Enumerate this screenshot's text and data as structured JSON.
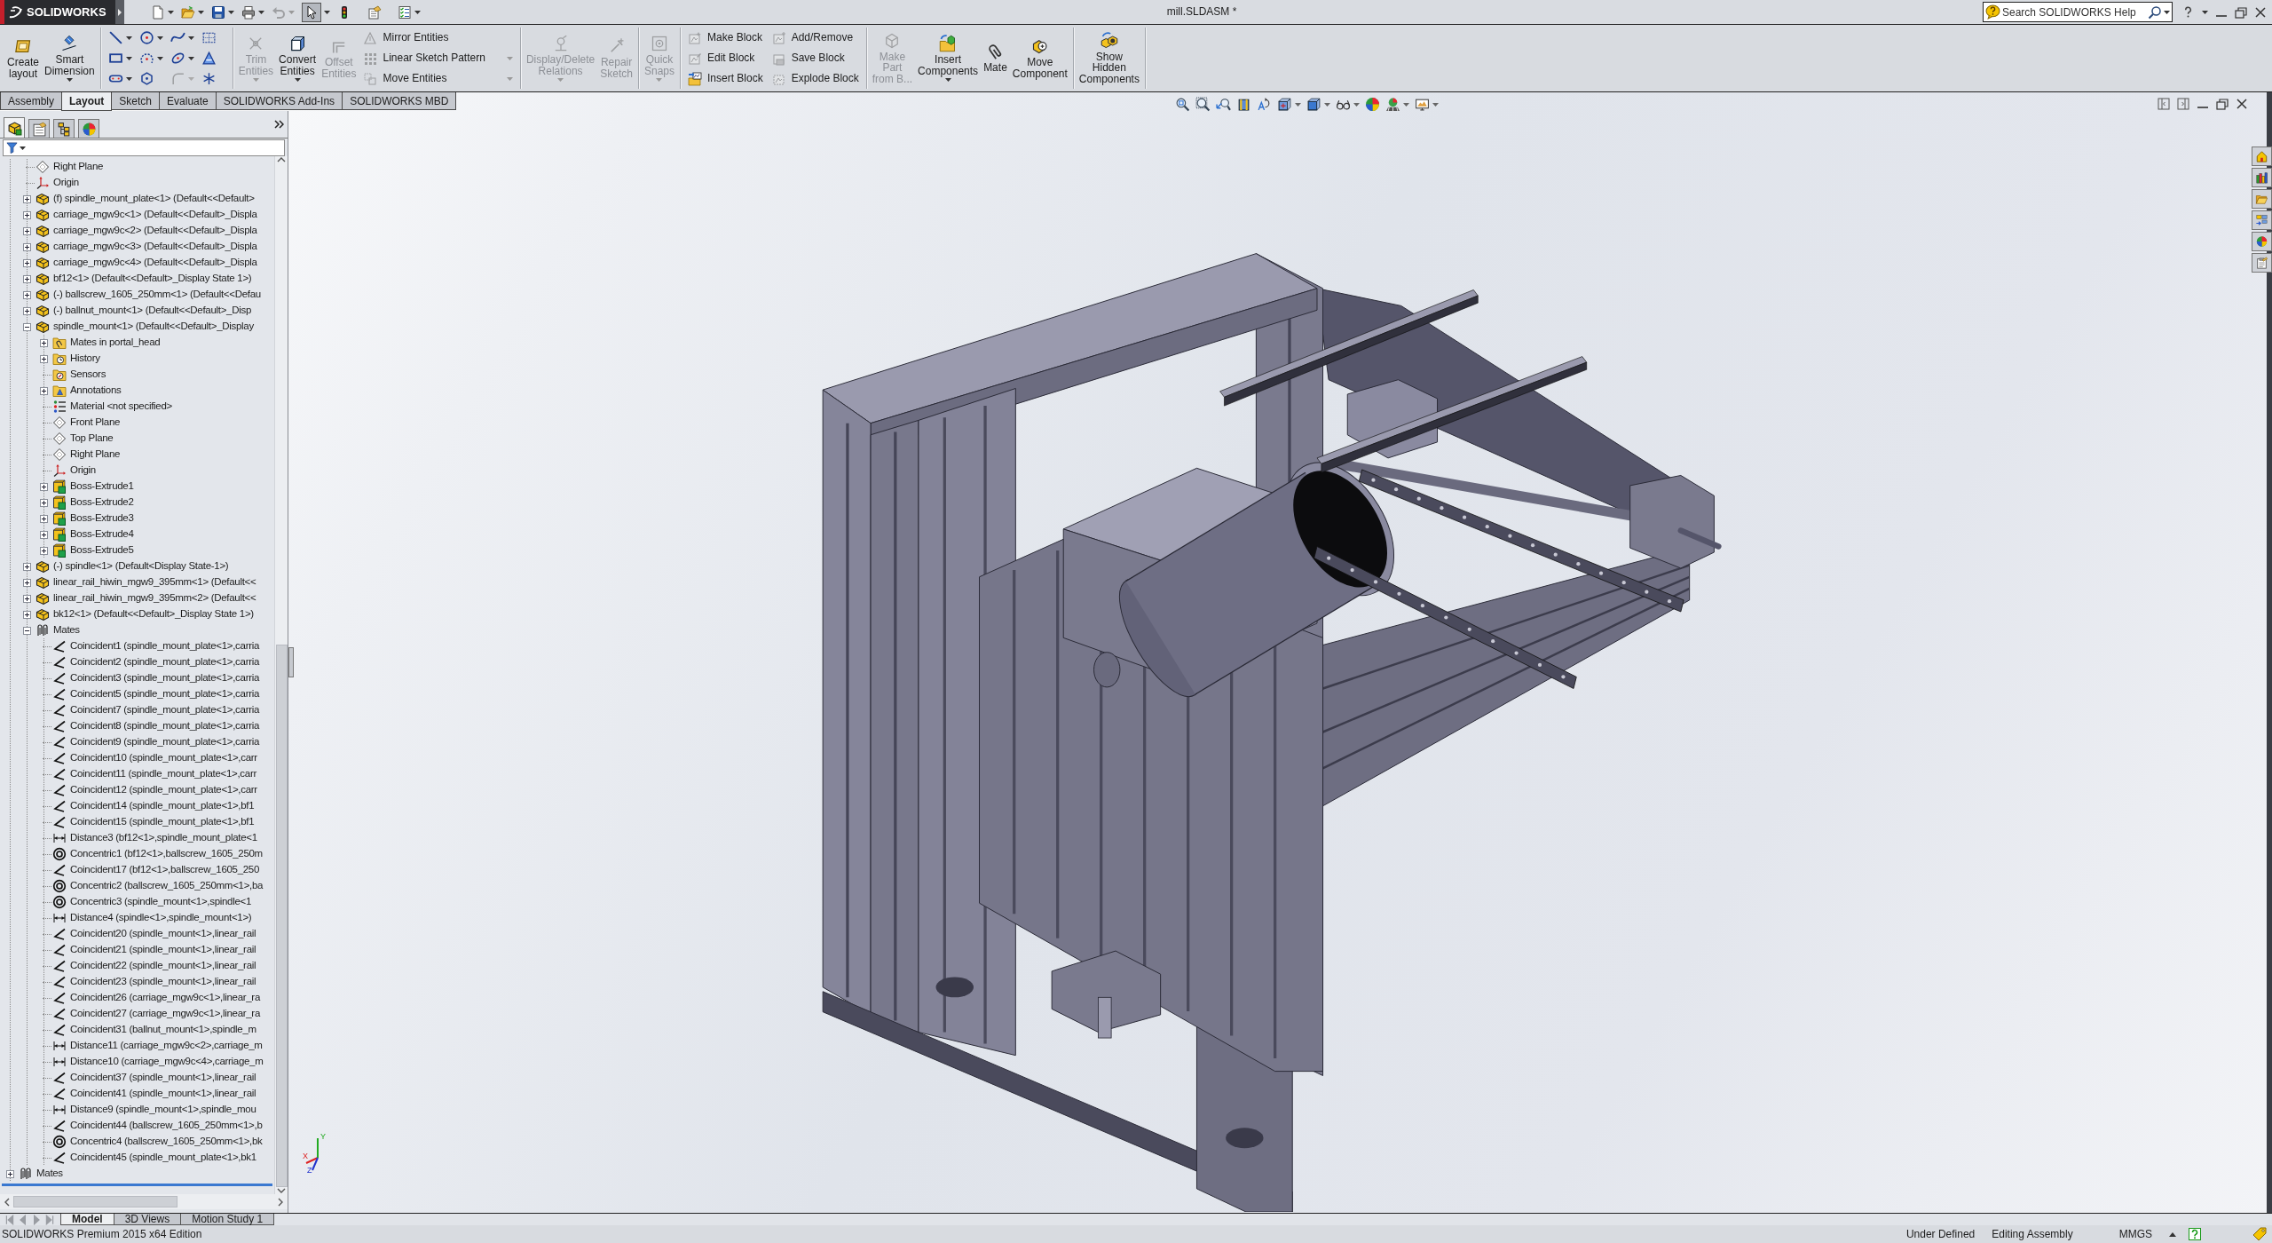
{
  "title_bar": {
    "logo": "SOLIDWORKS",
    "quick_access": [
      {
        "kind": "new",
        "dropdown": true,
        "disabled": false,
        "pressed": false
      },
      {
        "kind": "open",
        "dropdown": true,
        "disabled": false,
        "pressed": false
      },
      {
        "kind": "save",
        "dropdown": true,
        "disabled": false,
        "pressed": false
      },
      {
        "kind": "print",
        "dropdown": true,
        "disabled": false,
        "pressed": false
      },
      {
        "kind": "undo",
        "dropdown": true,
        "disabled": true,
        "pressed": false
      },
      {
        "kind": "select",
        "dropdown": true,
        "disabled": false,
        "pressed": true
      },
      {
        "kind": "rebuild",
        "dropdown": false,
        "disabled": false,
        "pressed": false
      },
      {
        "kind": "options",
        "dropdown": false,
        "disabled": false,
        "pressed": false
      },
      {
        "kind": "properties",
        "dropdown": true,
        "disabled": false,
        "pressed": false
      }
    ],
    "title": "mill.SLDASM *",
    "search": {
      "placeholder": "Search SOLIDWORKS Help"
    }
  },
  "ribbon": [
    {
      "sections": [
        {
          "kind": "large",
          "items": [
            {
              "kind": "layout",
              "label": "Create\nlayout",
              "dropdown": false,
              "disabled": false
            },
            {
              "kind": "dimension",
              "label": "Smart\nDimension",
              "dropdown": true,
              "disabled": false
            }
          ]
        }
      ]
    },
    {
      "sections": [
        {
          "kind": "tools",
          "items": [
            {
              "kind": "line",
              "dropdown": true,
              "disabled": false
            },
            {
              "kind": "circle",
              "dropdown": true,
              "disabled": false
            },
            {
              "kind": "spline",
              "dropdown": true,
              "disabled": false
            },
            {
              "kind": "grid",
              "dropdown": false,
              "disabled": false
            },
            {
              "kind": "rectangle",
              "dropdown": true,
              "disabled": false
            },
            {
              "kind": "arc",
              "dropdown": true,
              "disabled": false
            },
            {
              "kind": "ellipse",
              "dropdown": true,
              "disabled": false
            },
            {
              "kind": "text",
              "dropdown": false,
              "disabled": false
            },
            {
              "kind": "slot",
              "dropdown": true,
              "disabled": false
            },
            {
              "kind": "polygon",
              "dropdown": false,
              "disabled": false
            },
            {
              "kind": "fillet",
              "dropdown": true,
              "disabled": true
            },
            {
              "kind": "point",
              "dropdown": false,
              "disabled": false
            }
          ]
        }
      ]
    },
    {
      "sections": [
        {
          "kind": "large",
          "items": [
            {
              "kind": "trim",
              "label": "Trim\nEntities",
              "dropdown": true,
              "disabled": true
            },
            {
              "kind": "convert",
              "label": "Convert\nEntities",
              "dropdown": true,
              "disabled": false
            },
            {
              "kind": "offset",
              "label": "Offset\nEntities",
              "dropdown": false,
              "disabled": true
            }
          ]
        },
        {
          "kind": "stack",
          "items": [
            {
              "kind": "mirror",
              "label": "Mirror Entities",
              "dropdown": false,
              "disabled": true
            },
            {
              "kind": "pattern",
              "label": "Linear Sketch Pattern",
              "dropdown": true,
              "disabled": true
            },
            {
              "kind": "move",
              "label": "Move Entities",
              "dropdown": true,
              "disabled": true
            }
          ]
        }
      ]
    },
    {
      "sections": [
        {
          "kind": "large",
          "items": [
            {
              "kind": "relations",
              "label": "Display/Delete\nRelations",
              "dropdown": true,
              "disabled": true
            },
            {
              "kind": "repair",
              "label": "Repair\nSketch",
              "dropdown": false,
              "disabled": true
            }
          ]
        }
      ]
    },
    {
      "sections": [
        {
          "kind": "large",
          "items": [
            {
              "kind": "snaps",
              "label": "Quick\nSnaps",
              "dropdown": true,
              "disabled": true
            }
          ]
        }
      ]
    },
    {
      "sections": [
        {
          "kind": "stack",
          "items": [
            {
              "kind": "makeblock",
              "label": "Make Block",
              "dropdown": false,
              "disabled": true
            },
            {
              "kind": "editblock",
              "label": "Edit Block",
              "dropdown": false,
              "disabled": true
            },
            {
              "kind": "insertblock",
              "label": "Insert Block",
              "dropdown": false,
              "disabled": false
            }
          ]
        },
        {
          "kind": "stack",
          "items": [
            {
              "kind": "addremove",
              "label": "Add/Remove",
              "dropdown": false,
              "disabled": true
            },
            {
              "kind": "saveblock",
              "label": "Save Block",
              "dropdown": false,
              "disabled": true
            },
            {
              "kind": "explodeblock",
              "label": "Explode Block",
              "dropdown": false,
              "disabled": true
            }
          ]
        }
      ]
    },
    {
      "sections": [
        {
          "kind": "large",
          "items": [
            {
              "kind": "makepart",
              "label": "Make\nPart\nfrom B...",
              "dropdown": false,
              "disabled": true
            },
            {
              "kind": "insert",
              "label": "Insert\nComponents",
              "dropdown": true,
              "disabled": false
            },
            {
              "kind": "mate",
              "label": "Mate",
              "dropdown": false,
              "disabled": false
            },
            {
              "kind": "movecomponent",
              "label": "Move\nComponent",
              "dropdown": false,
              "disabled": false
            }
          ]
        }
      ]
    },
    {
      "sections": [
        {
          "kind": "large",
          "items": [
            {
              "kind": "showhidden",
              "label": "Show\nHidden\nComponents",
              "dropdown": false,
              "disabled": false
            }
          ]
        }
      ]
    }
  ],
  "command_tabs": [
    {
      "label": "Assembly",
      "selected": false
    },
    {
      "label": "Layout",
      "selected": true
    },
    {
      "label": "Sketch",
      "selected": false
    },
    {
      "label": "Evaluate",
      "selected": false
    },
    {
      "label": "SOLIDWORKS Add-Ins",
      "selected": false
    },
    {
      "label": "SOLIDWORKS MBD",
      "selected": false
    }
  ],
  "view_toolbar": [
    {
      "kind": "zoomfit",
      "dropdown": false
    },
    {
      "kind": "zoomarea",
      "dropdown": false
    },
    {
      "kind": "previous",
      "dropdown": false
    },
    {
      "kind": "section",
      "dropdown": false
    },
    {
      "kind": "annotation",
      "dropdown": false
    },
    {
      "kind": "orientation",
      "dropdown": true
    },
    {
      "kind": "style",
      "dropdown": true
    },
    {
      "kind": "visibility",
      "dropdown": true
    },
    {
      "kind": "appearance",
      "dropdown": false
    },
    {
      "kind": "scene",
      "dropdown": true
    },
    {
      "kind": "settings",
      "dropdown": true
    }
  ],
  "feature_tree": {
    "tabs": [
      {
        "kind": "features",
        "selected": true
      },
      {
        "kind": "properties",
        "selected": false
      },
      {
        "kind": "configurations",
        "selected": false
      },
      {
        "kind": "display",
        "selected": false
      }
    ],
    "items": [
      {
        "children": [
          {
            "label": "Right Plane",
            "kind": "plane"
          },
          {
            "label": "Origin",
            "kind": "origin"
          },
          {
            "label": "(f) spindle_mount_plate<1> (Default<<Default>",
            "kind": "part",
            "expanded": false
          },
          {
            "label": "carriage_mgw9c<1> (Default<<Default>_Displa",
            "kind": "part",
            "expanded": false
          },
          {
            "label": "carriage_mgw9c<2> (Default<<Default>_Displa",
            "kind": "part",
            "expanded": false
          },
          {
            "label": "carriage_mgw9c<3> (Default<<Default>_Displa",
            "kind": "part",
            "expanded": false
          },
          {
            "label": "carriage_mgw9c<4> (Default<<Default>_Displa",
            "kind": "part",
            "expanded": false
          },
          {
            "label": "bf12<1> (Default<<Default>_Display State 1>)",
            "kind": "part",
            "expanded": false
          },
          {
            "label": "(-) ballscrew_1605_250mm<1> (Default<<Defau",
            "kind": "part",
            "expanded": false
          },
          {
            "label": "(-) ballnut_mount<1> (Default<<Default>_Disp",
            "kind": "part",
            "expanded": false
          },
          {
            "label": "spindle_mount<1> (Default<<Default>_Display",
            "kind": "part",
            "expanded": true,
            "children": [
              {
                "label": "Mates in portal_head",
                "kind": "matefolder",
                "expanded": false
              },
              {
                "label": "History",
                "kind": "history",
                "expanded": false
              },
              {
                "label": "Sensors",
                "kind": "sensors"
              },
              {
                "label": "Annotations",
                "kind": "annotations",
                "expanded": false
              },
              {
                "label": "Material <not specified>",
                "kind": "material"
              },
              {
                "label": "Front Plane",
                "kind": "plane"
              },
              {
                "label": "Top Plane",
                "kind": "plane"
              },
              {
                "label": "Right Plane",
                "kind": "plane"
              },
              {
                "label": "Origin",
                "kind": "origin"
              },
              {
                "label": "Boss-Extrude1",
                "kind": "extrude",
                "expanded": false
              },
              {
                "label": "Boss-Extrude2",
                "kind": "extrude",
                "expanded": false
              },
              {
                "label": "Boss-Extrude3",
                "kind": "extrude",
                "expanded": false
              },
              {
                "label": "Boss-Extrude4",
                "kind": "extrude",
                "expanded": false
              },
              {
                "label": "Boss-Extrude5",
                "kind": "extrude",
                "expanded": false
              }
            ]
          },
          {
            "label": "(-) spindle<1> (Default<Display State-1>)",
            "kind": "part",
            "expanded": false
          },
          {
            "label": "linear_rail_hiwin_mgw9_395mm<1> (Default<<",
            "kind": "part",
            "expanded": false
          },
          {
            "label": "linear_rail_hiwin_mgw9_395mm<2> (Default<<",
            "kind": "part",
            "expanded": false
          },
          {
            "label": "bk12<1> (Default<<Default>_Display State 1>)",
            "kind": "part",
            "expanded": false
          },
          {
            "label": "Mates",
            "kind": "mates",
            "expanded": true,
            "children": [
              {
                "label": "Coincident1 (spindle_mount_plate<1>,carria",
                "kind": "coincident"
              },
              {
                "label": "Coincident2 (spindle_mount_plate<1>,carria",
                "kind": "coincident"
              },
              {
                "label": "Coincident3 (spindle_mount_plate<1>,carria",
                "kind": "coincident"
              },
              {
                "label": "Coincident5 (spindle_mount_plate<1>,carria",
                "kind": "coincident"
              },
              {
                "label": "Coincident7 (spindle_mount_plate<1>,carria",
                "kind": "coincident"
              },
              {
                "label": "Coincident8 (spindle_mount_plate<1>,carria",
                "kind": "coincident"
              },
              {
                "label": "Coincident9 (spindle_mount_plate<1>,carria",
                "kind": "coincident"
              },
              {
                "label": "Coincident10 (spindle_mount_plate<1>,carr",
                "kind": "coincident"
              },
              {
                "label": "Coincident11 (spindle_mount_plate<1>,carr",
                "kind": "coincident"
              },
              {
                "label": "Coincident12 (spindle_mount_plate<1>,carr",
                "kind": "coincident"
              },
              {
                "label": "Coincident14 (spindle_mount_plate<1>,bf1",
                "kind": "coincident"
              },
              {
                "label": "Coincident15 (spindle_mount_plate<1>,bf1",
                "kind": "coincident"
              },
              {
                "label": "Distance3 (bf12<1>,spindle_mount_plate<1",
                "kind": "distance"
              },
              {
                "label": "Concentric1 (bf12<1>,ballscrew_1605_250m",
                "kind": "concentric"
              },
              {
                "label": "Coincident17 (bf12<1>,ballscrew_1605_250",
                "kind": "coincident"
              },
              {
                "label": "Concentric2 (ballscrew_1605_250mm<1>,ba",
                "kind": "concentric"
              },
              {
                "label": "Concentric3 (spindle_mount<1>,spindle<1",
                "kind": "concentric"
              },
              {
                "label": "Distance4 (spindle<1>,spindle_mount<1>)",
                "kind": "distance"
              },
              {
                "label": "Coincident20 (spindle_mount<1>,linear_rail",
                "kind": "coincident"
              },
              {
                "label": "Coincident21 (spindle_mount<1>,linear_rail",
                "kind": "coincident"
              },
              {
                "label": "Coincident22 (spindle_mount<1>,linear_rail",
                "kind": "coincident"
              },
              {
                "label": "Coincident23 (spindle_mount<1>,linear_rail",
                "kind": "coincident"
              },
              {
                "label": "Coincident26 (carriage_mgw9c<1>,linear_ra",
                "kind": "coincident"
              },
              {
                "label": "Coincident27 (carriage_mgw9c<1>,linear_ra",
                "kind": "coincident"
              },
              {
                "label": "Coincident31 (ballnut_mount<1>,spindle_m",
                "kind": "coincident"
              },
              {
                "label": "Distance11 (carriage_mgw9c<2>,carriage_m",
                "kind": "distance"
              },
              {
                "label": "Distance10 (carriage_mgw9c<4>,carriage_m",
                "kind": "distance"
              },
              {
                "label": "Coincident37 (spindle_mount<1>,linear_rail",
                "kind": "coincident"
              },
              {
                "label": "Coincident41 (spindle_mount<1>,linear_rail",
                "kind": "coincident"
              },
              {
                "label": "Distance9 (spindle_mount<1>,spindle_mou",
                "kind": "distance"
              },
              {
                "label": "Coincident44 (ballscrew_1605_250mm<1>,b",
                "kind": "coincident"
              },
              {
                "label": "Concentric4 (ballscrew_1605_250mm<1>,bk",
                "kind": "concentric"
              },
              {
                "label": "Coincident45 (spindle_mount_plate<1>,bk1",
                "kind": "coincident"
              }
            ]
          }
        ]
      },
      {
        "label": "Mates",
        "kind": "mates",
        "expanded": false
      }
    ]
  },
  "bottom_tabs": [
    {
      "label": "Model",
      "selected": true
    },
    {
      "label": "3D Views",
      "selected": false
    },
    {
      "label": "Motion Study 1",
      "selected": false
    }
  ],
  "triad_axes": [
    "X",
    "Y",
    "Z"
  ],
  "status_bar": {
    "edition": "SOLIDWORKS Premium 2015 x64 Edition",
    "items": [
      "Under Defined",
      "Editing Assembly",
      "MMGS"
    ]
  }
}
